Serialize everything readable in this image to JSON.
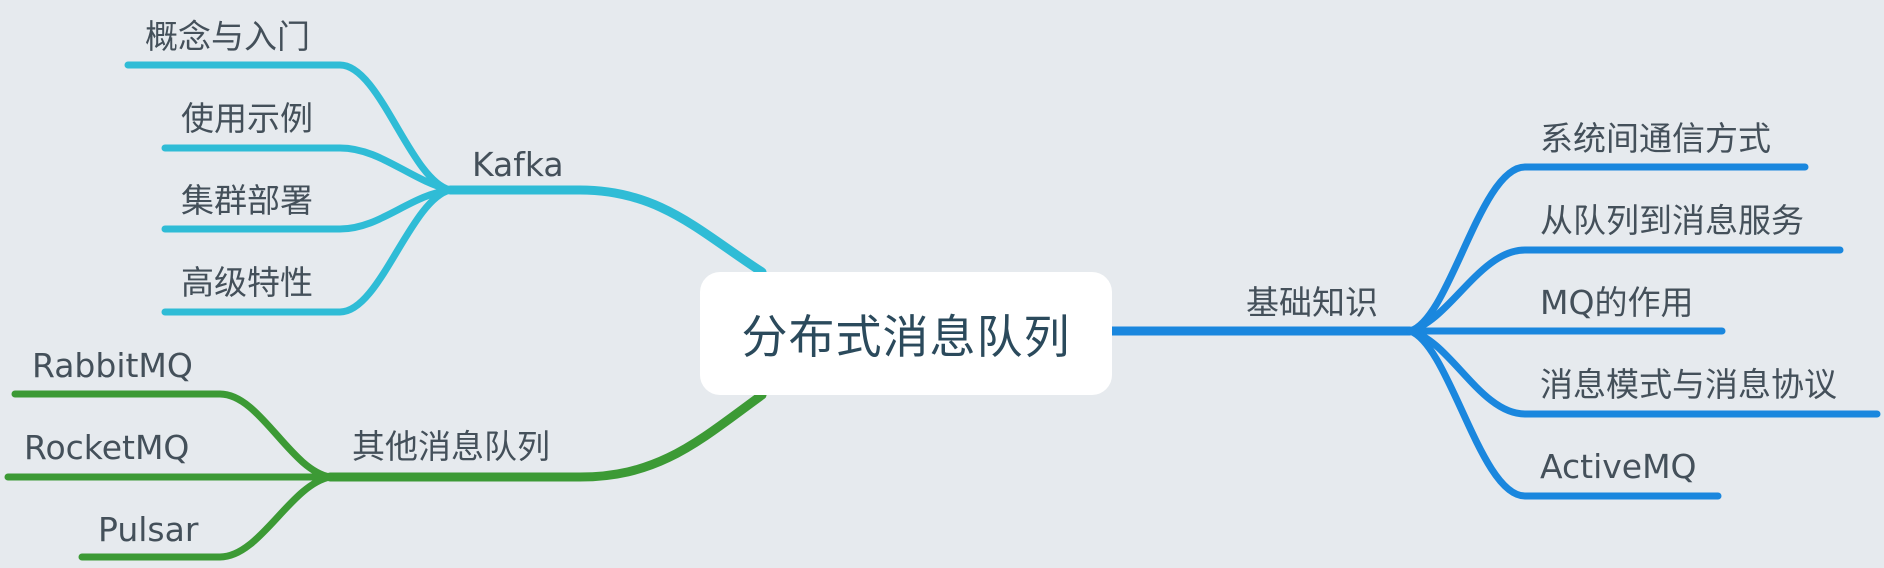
{
  "root": {
    "label": "分布式消息队列"
  },
  "colors": {
    "background": "#e6eaee",
    "kafka": "#2fbcd6",
    "other": "#3c9a35",
    "basics": "#1a87de",
    "text": "#44505a",
    "root_text": "#2b4a5c"
  },
  "branches": {
    "kafka": {
      "label": "Kafka",
      "children": [
        "概念与入门",
        "使用示例",
        "集群部署",
        "高级特性"
      ]
    },
    "other": {
      "label": "其他消息队列",
      "children": [
        "RabbitMQ",
        "RocketMQ",
        "Pulsar"
      ]
    },
    "basics": {
      "label": "基础知识",
      "children": [
        "系统间通信方式",
        "从队列到消息服务",
        "MQ的作用",
        "消息模式与消息协议",
        "ActiveMQ"
      ]
    }
  }
}
